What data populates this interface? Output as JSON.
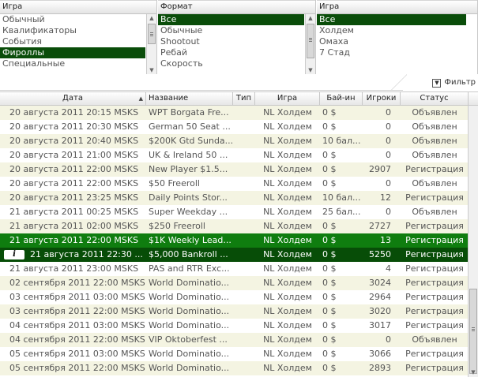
{
  "filters": [
    {
      "title": "Игра",
      "items": [
        "Обычный",
        "Квалификаторы",
        "События",
        "Фироллы",
        "Специальные"
      ],
      "selected": 3
    },
    {
      "title": "Формат",
      "items": [
        "Все",
        "Обычные",
        "Shootout",
        "Ребай",
        "Скорость"
      ],
      "selected": 0
    },
    {
      "title": "Игра",
      "items": [
        "Все",
        "Холдем",
        "Омаха",
        "7 Стад"
      ],
      "selected": 0
    }
  ],
  "toolbar": {
    "filter_label": "Фильтр"
  },
  "grid": {
    "columns": [
      "Дата",
      "Название",
      "Тип",
      "Игра",
      "Бай-ин",
      "Игроки",
      "Статус"
    ],
    "rows": [
      [
        "20 августа 2011 20:15 MSKS",
        "WPT Borgata Fre...",
        "",
        "NL Холдем",
        "0 $",
        "0",
        "Объявлен"
      ],
      [
        "20 августа 2011 20:30 MSKS",
        "German 50 Seat ...",
        "",
        "NL Холдем",
        "0 $",
        "0",
        "Объявлен"
      ],
      [
        "20 августа 2011 20:40 MSKS",
        "$200K Gtd Sunda...",
        "",
        "NL Холдем",
        "10 бал...",
        "0",
        "Объявлен"
      ],
      [
        "20 августа 2011 21:00 MSKS",
        "UK & Ireland 50 ...",
        "",
        "NL Холдем",
        "0 $",
        "0",
        "Объявлен"
      ],
      [
        "20 августа 2011 22:00 MSKS",
        "New Player $1.5...",
        "",
        "NL Холдем",
        "0 $",
        "2907",
        "Регистрация"
      ],
      [
        "20 августа 2011 22:00 MSKS",
        "$50 Freeroll",
        "",
        "NL Холдем",
        "0 $",
        "0",
        "Объявлен"
      ],
      [
        "20 августа 2011 23:25 MSKS",
        "Daily Points Stor...",
        "",
        "NL Холдем",
        "10 бал...",
        "12",
        "Регистрация"
      ],
      [
        "21 августа 2011 00:25 MSKS",
        "Super Weekday ...",
        "",
        "NL Холдем",
        "25 бал...",
        "0",
        "Объявлен"
      ],
      [
        "21 августа 2011 02:00 MSKS",
        "$250 Freeroll",
        "",
        "NL Холдем",
        "0 $",
        "2727",
        "Регистрация"
      ],
      [
        "21 августа 2011 22:00 MSKS",
        "$1K Weekly Lead...",
        "",
        "NL Холдем",
        "0 $",
        "13",
        "Регистрация"
      ],
      [
        "21 августа 2011 22:30 ...",
        "$5,000 Bankroll ...",
        "",
        "NL Холдем",
        "0 $",
        "5250",
        "Регистрация"
      ],
      [
        "21 августа 2011 23:00 MSKS",
        "PAS and RTR Exc...",
        "",
        "NL Холдем",
        "0 $",
        "4",
        "Регистрация"
      ],
      [
        "02 сентября 2011 22:00 MSKS",
        "World Dominatio...",
        "",
        "NL Холдем",
        "0 $",
        "3024",
        "Регистрация"
      ],
      [
        "03 сентября 2011 03:00 MSKS",
        "World Dominatio...",
        "",
        "NL Холдем",
        "0 $",
        "2964",
        "Регистрация"
      ],
      [
        "03 сентября 2011 22:00 MSKS",
        "World Dominatio...",
        "",
        "NL Холдем",
        "0 $",
        "3020",
        "Регистрация"
      ],
      [
        "04 сентября 2011 03:00 MSKS",
        "World Dominatio...",
        "",
        "NL Холдем",
        "0 $",
        "3017",
        "Регистрация"
      ],
      [
        "04 сентября 2011 22:00 MSKS",
        "VIP Oktoberfest ...",
        "",
        "NL Холдем",
        "0 $",
        "0",
        "Объявлен"
      ],
      [
        "05 сентября 2011 03:00 MSKS",
        "World Dominatio...",
        "",
        "NL Холдем",
        "0 $",
        "3066",
        "Регистрация"
      ],
      [
        "05 сентября 2011 22:00 MSKS",
        "World Dominatio...",
        "",
        "NL Холдем",
        "0 $",
        "2893",
        "Регистрация"
      ]
    ],
    "selected_row": 9,
    "highlighted_row": 10
  },
  "colors": {
    "selected": "#0f7d0f",
    "highlight": "#074d07",
    "list_selected": "#0a4d0a",
    "alt_row": "#f4f4e2"
  },
  "icons": {
    "info": "info-icon",
    "sort": "sort-arrow-icon",
    "filter": "filter-icon"
  }
}
